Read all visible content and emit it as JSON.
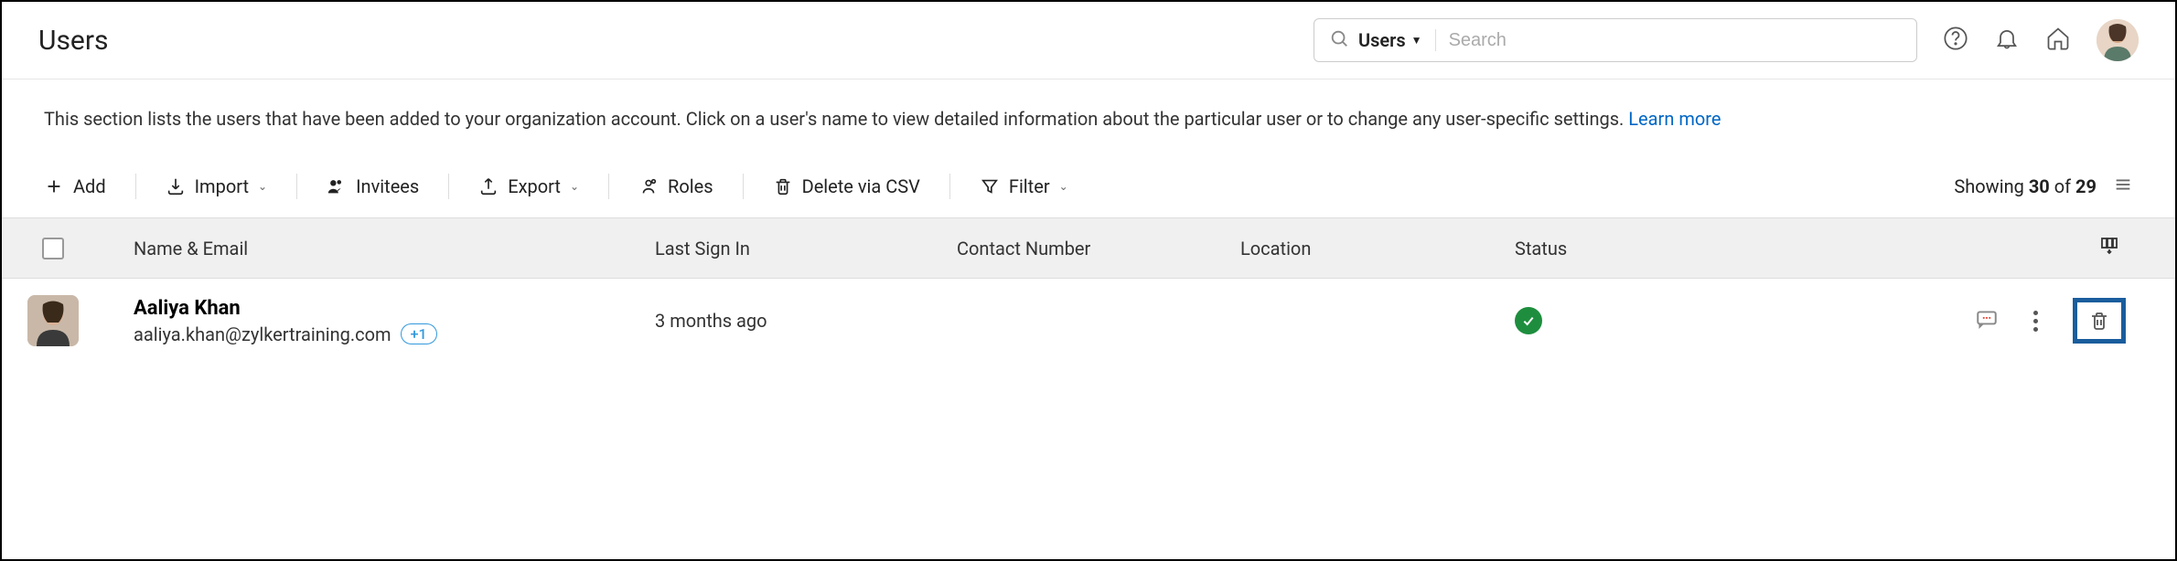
{
  "header": {
    "title": "Users",
    "search_scope": "Users",
    "search_placeholder": "Search"
  },
  "description": {
    "text": "This section lists the users that have been added to your organization account. Click on a user's name to view detailed information about the particular user or to change any user-specific settings.  ",
    "learn_more": "Learn more"
  },
  "toolbar": {
    "add": "Add",
    "import": "Import",
    "invitees": "Invitees",
    "export": "Export",
    "roles": "Roles",
    "delete_csv": "Delete via CSV",
    "filter": "Filter",
    "showing": "Showing ",
    "range": "30",
    "of": " of ",
    "total": "29"
  },
  "columns": {
    "name_email": "Name & Email",
    "last_signin": "Last Sign In",
    "contact": "Contact Number",
    "location": "Location",
    "status": "Status"
  },
  "rows": [
    {
      "name": "Aaliya Khan",
      "email": "aaliya.khan@zylkertraining.com",
      "badge": "+1",
      "last_signin": "3 months ago",
      "contact": "",
      "location": "",
      "status": "active"
    }
  ]
}
